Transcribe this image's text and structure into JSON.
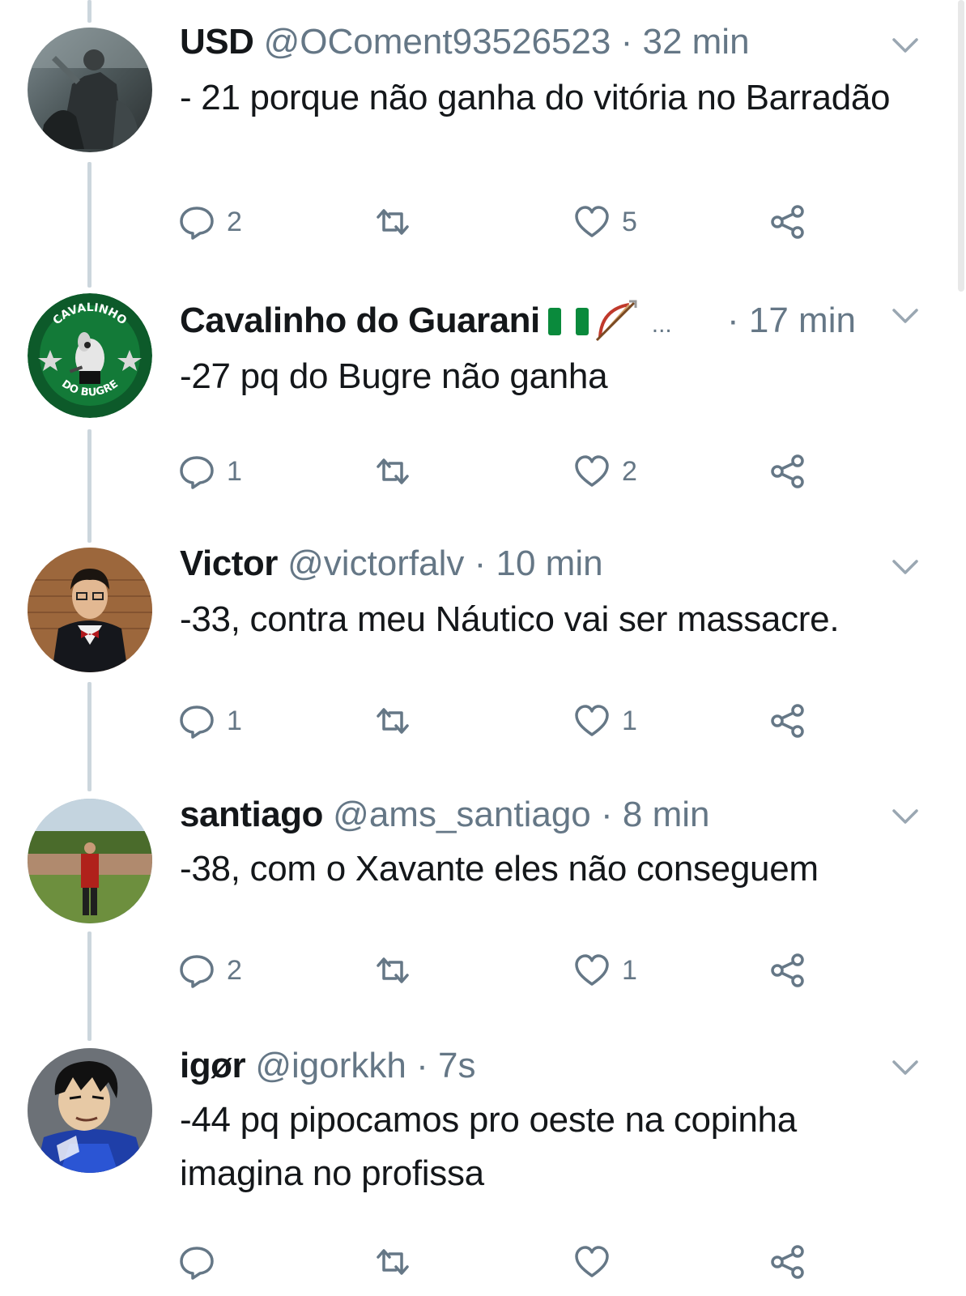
{
  "tweets": [
    {
      "name": "USD",
      "handle": "@OComent93526523",
      "sep": " · ",
      "time": "32 min",
      "text": "- 21 porque não ganha do vitória no Barradão",
      "replies": "2",
      "retweets": "",
      "likes": "5",
      "avatar": "rider-photo-avatar"
    },
    {
      "name": "Cavalinho do Guarani",
      "handle": "",
      "sep": "",
      "time": "· 17 min",
      "ellipsis": "...",
      "emojis": [
        "nigeria-flag-emoji",
        "bow-and-arrow-emoji"
      ],
      "text": "-27 pq do Bugre não ganha",
      "replies": "1",
      "retweets": "",
      "likes": "2",
      "avatar": "cavalinho-logo-avatar",
      "avatar_text": {
        "top": "CAVALINHO",
        "bottom": "DO BUGRE"
      }
    },
    {
      "name": "Victor",
      "handle": "@victorfalv",
      "sep": " · ",
      "time": "10 min",
      "text": "-33, contra meu Náutico vai ser massacre.",
      "replies": "1",
      "retweets": "",
      "likes": "1",
      "avatar": "suit-photo-avatar"
    },
    {
      "name": "santiago",
      "handle": "@ams_santiago",
      "sep": " · ",
      "time": "8 min",
      "text": "-38, com o Xavante eles não conseguem",
      "replies": "2",
      "retweets": "",
      "likes": "1",
      "avatar": "field-photo-avatar"
    },
    {
      "name": "igør",
      "handle": "@igorkkh",
      "sep": " · ",
      "time": "7s",
      "text": "-44 pq pipocamos pro oeste na copinha imagina no profissa",
      "replies": "",
      "retweets": "",
      "likes": "",
      "avatar": "cartoon-avatar"
    }
  ],
  "colors": {
    "text": "#14171a",
    "secondary": "#657786",
    "thread_line": "#ccd6dd",
    "background": "#ffffff"
  },
  "icons": {
    "reply": "reply-icon",
    "retweet": "retweet-icon",
    "like": "heart-icon",
    "share": "share-icon",
    "menu": "chevron-down-icon"
  }
}
